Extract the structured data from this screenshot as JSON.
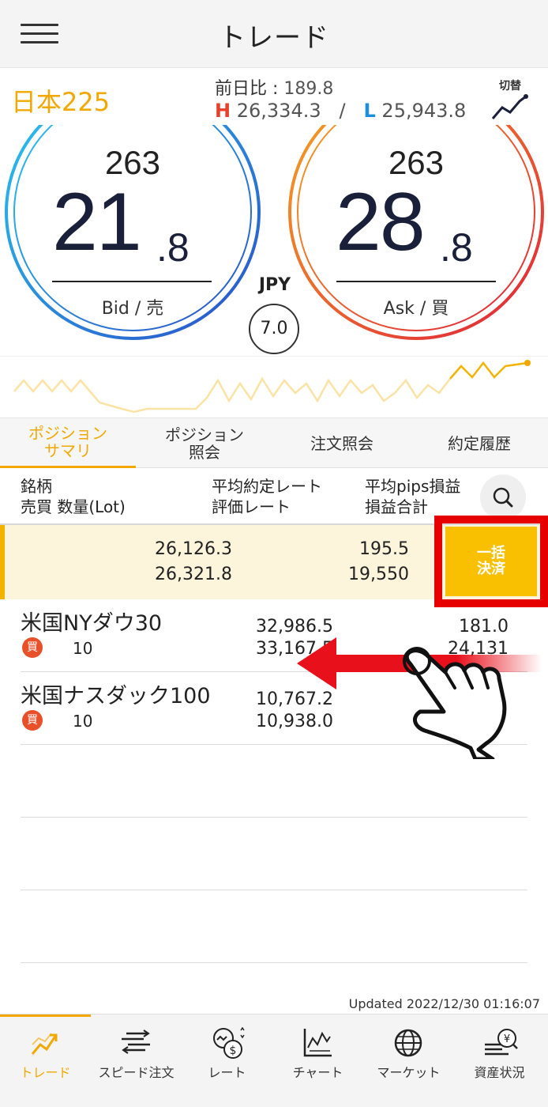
{
  "header": {
    "title": "トレード"
  },
  "symbol": {
    "name": "日本225",
    "prev_close_label": "前日比 : ",
    "prev_close_value": "189.8",
    "high_mark": "H",
    "high_value": "26,334.3",
    "separator": "/",
    "low_mark": "L",
    "low_value": "25,943.8",
    "switch_label": "切替"
  },
  "bid": {
    "lead": "263",
    "main": "21",
    "decimal": ".8",
    "label": "Bid / 売"
  },
  "ask": {
    "lead": "263",
    "main": "28",
    "decimal": ".8",
    "label": "Ask / 買"
  },
  "currency": "JPY",
  "spread": "7.0",
  "tabs": [
    {
      "label": "ポジション\nサマリ",
      "active": true
    },
    {
      "label": "ポジション\n照会",
      "active": false
    },
    {
      "label": "注文照会",
      "active": false
    },
    {
      "label": "約定履歴",
      "active": false
    }
  ],
  "columns": {
    "symbol": "銘柄\n売買 数量(Lot)",
    "rate": "平均約定レート\n評価レート",
    "pips": "平均pips損益\n損益合計"
  },
  "summary": {
    "avg_rate": "26,126.3",
    "eval_rate": "26,321.8",
    "avg_pips": "195.5",
    "total_pl": "19,550",
    "bulk_button": "一括\n決済"
  },
  "positions": [
    {
      "name": "米国NYダウ30",
      "side": "買",
      "lot": "10",
      "avg_rate": "32,986.5",
      "eval_rate": "33,167.5",
      "pips": "181.0",
      "pl": "24,131"
    },
    {
      "name": "米国ナスダック100",
      "side": "買",
      "lot": "10",
      "avg_rate": "10,767.2",
      "eval_rate": "10,938.0",
      "pips": "",
      "pl": ""
    }
  ],
  "updated": "Updated  2022/12/30 01:16:07",
  "nav": [
    {
      "label": "トレード",
      "icon": "trend-up-icon",
      "active": true
    },
    {
      "label": "スピード注文",
      "icon": "speed-order-icon",
      "active": false
    },
    {
      "label": "レート",
      "icon": "rate-icon",
      "active": false
    },
    {
      "label": "チャート",
      "icon": "chart-icon",
      "active": false
    },
    {
      "label": "マーケット",
      "icon": "globe-icon",
      "active": false
    },
    {
      "label": "資産状況",
      "icon": "assets-icon",
      "active": false
    }
  ],
  "colors": {
    "accent": "#f2a800",
    "bid_ring": "#1a8fe0",
    "ask_ring": "#e8402a",
    "highlight_frame": "#e60000",
    "buy_badge": "#e8502a"
  }
}
